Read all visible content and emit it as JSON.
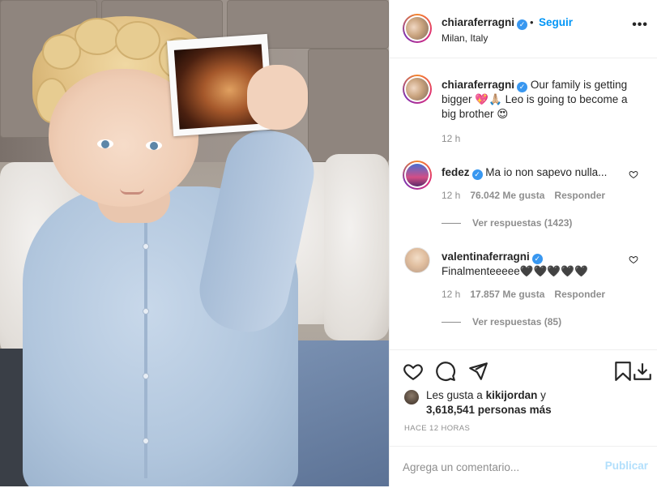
{
  "photo": {
    "alt_subject": ""
  },
  "header": {
    "username": "chiaraferragni",
    "follow_label": "Seguir",
    "separator": "•",
    "location": "Milan, Italy",
    "more_label": "•••"
  },
  "caption": {
    "username": "chiaraferragni",
    "text": "Our family is getting bigger 💖🙏🏼 Leo is going to become a big brother 😍",
    "time": "12 h"
  },
  "comments": [
    {
      "username": "fedez",
      "text": "Ma io non sapevo nulla...",
      "time": "12 h",
      "likes": "76.042 Me gusta",
      "reply_label": "Responder",
      "view_replies": "Ver respuestas (1423)"
    },
    {
      "username": "valentinaferragni",
      "text": "Finalmenteeeee🖤🖤🖤🖤🖤",
      "time": "12 h",
      "likes": "17.857 Me gusta",
      "reply_label": "Responder",
      "view_replies": "Ver respuestas (85)"
    }
  ],
  "likes": {
    "prefix": "Les gusta a",
    "user": "kikijordan",
    "suffix": "y",
    "count": "3,618,541 personas más"
  },
  "time_ago": "HACE 12 HORAS",
  "add_comment": {
    "placeholder": "Agrega un comentario...",
    "publish_label": "Publicar"
  },
  "colors": {
    "accent": "#0095f6",
    "verified": "#3897f0",
    "muted": "#8e8e8e",
    "text": "#262626"
  }
}
